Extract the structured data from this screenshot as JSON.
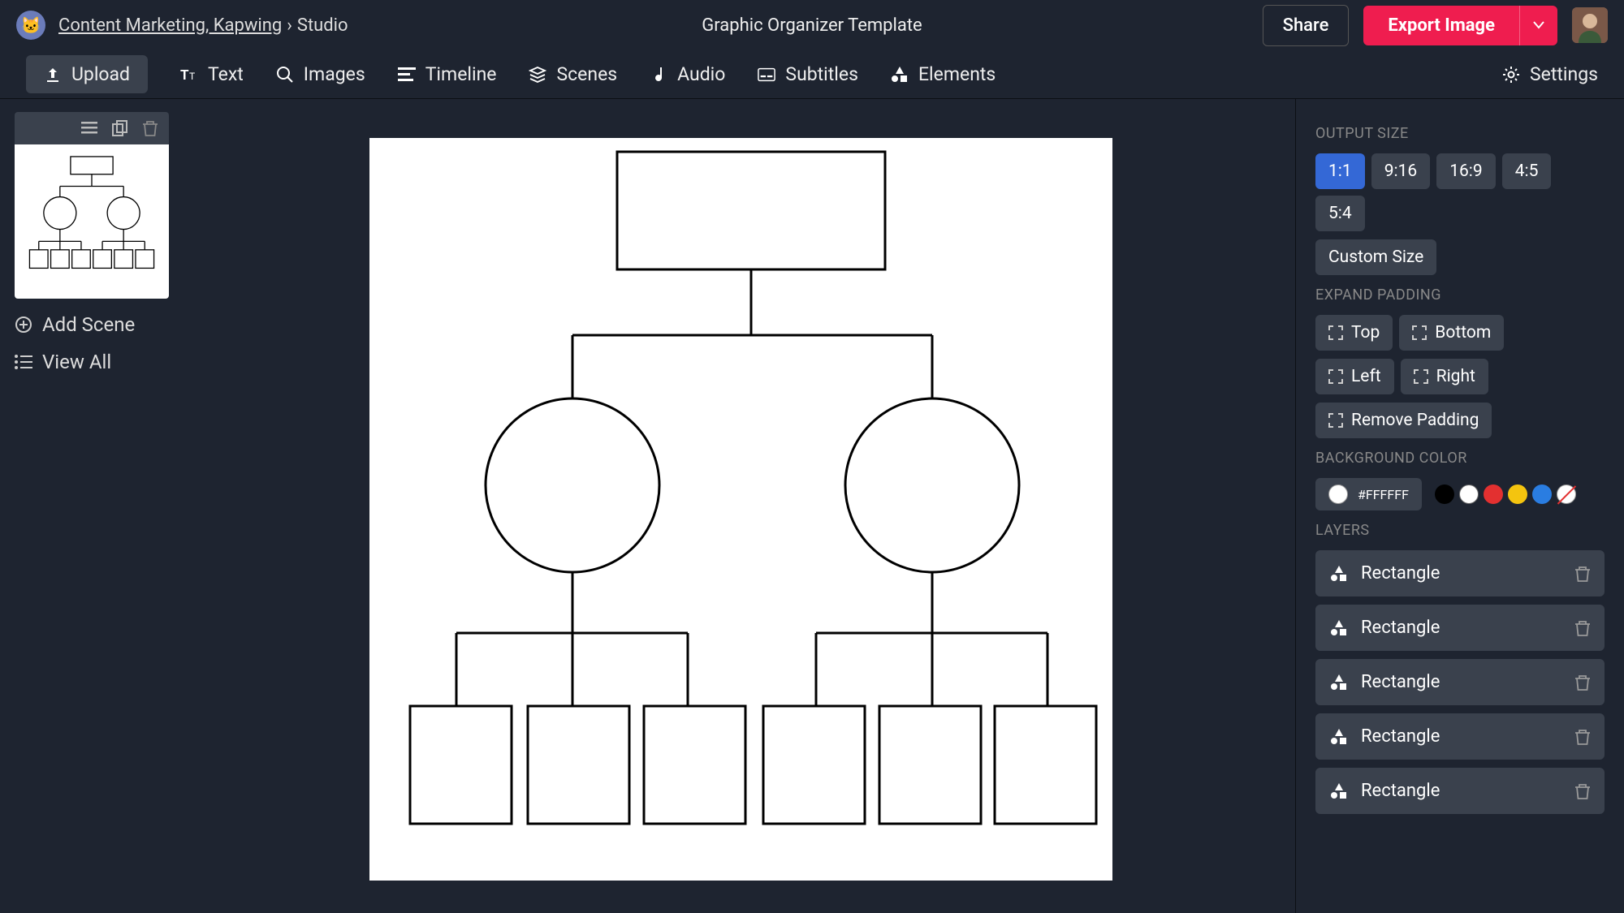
{
  "header": {
    "breadcrumb_link": "Content Marketing, Kapwing",
    "breadcrumb_sep": "›",
    "breadcrumb_current": "Studio",
    "title": "Graphic Organizer Template",
    "share": "Share",
    "export": "Export Image"
  },
  "toolbar": {
    "upload": "Upload",
    "text": "Text",
    "images": "Images",
    "timeline": "Timeline",
    "scenes": "Scenes",
    "audio": "Audio",
    "subtitles": "Subtitles",
    "elements": "Elements",
    "settings": "Settings"
  },
  "left": {
    "add_scene": "Add Scene",
    "view_all": "View All"
  },
  "right": {
    "output_size_label": "OUTPUT SIZE",
    "ratios": [
      "1:1",
      "9:16",
      "16:9",
      "4:5",
      "5:4"
    ],
    "custom_size": "Custom Size",
    "expand_label": "EXPAND PADDING",
    "pad_top": "Top",
    "pad_bottom": "Bottom",
    "pad_left": "Left",
    "pad_right": "Right",
    "remove_padding": "Remove Padding",
    "bg_label": "BACKGROUND COLOR",
    "bg_value": "#FFFFFF",
    "layers_label": "LAYERS",
    "layer_name": "Rectangle",
    "swatch_colors": [
      "#000000",
      "#ffffff",
      "#e33030",
      "#f4c40f",
      "#2a7de1"
    ]
  }
}
